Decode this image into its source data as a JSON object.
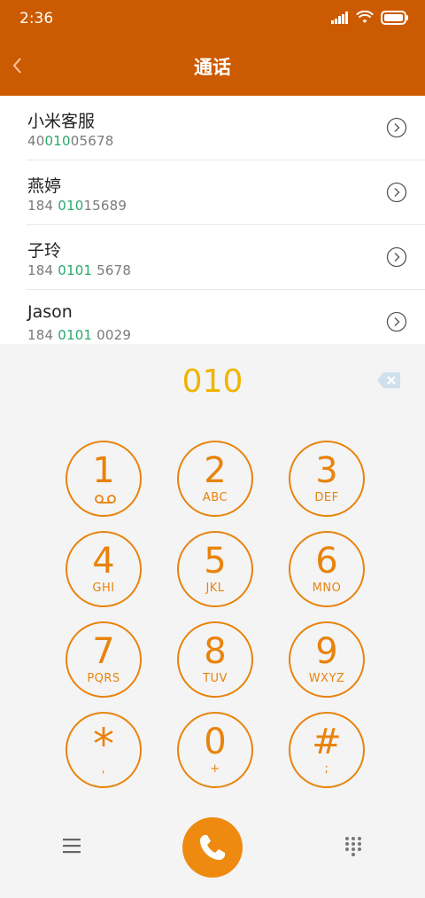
{
  "status_bar": {
    "time": "2:36"
  },
  "header": {
    "title": "通话"
  },
  "results": [
    {
      "name": "小米客服",
      "num_pre": "40",
      "num_hl": "010",
      "num_post": "05678"
    },
    {
      "name": "燕婷",
      "num_pre": "184 ",
      "num_hl": "010",
      "num_post": "15689"
    },
    {
      "name": "子玲",
      "num_pre": "184 ",
      "num_hl": "0101",
      "num_post": " 5678"
    },
    {
      "name": "Jason",
      "num_pre": "184 ",
      "num_hl": "0101",
      "num_post": " 0029"
    }
  ],
  "dialer": {
    "entered": "010",
    "keys": [
      {
        "digit": "1",
        "letters": ""
      },
      {
        "digit": "2",
        "letters": "ABC"
      },
      {
        "digit": "3",
        "letters": "DEF"
      },
      {
        "digit": "4",
        "letters": "GHI"
      },
      {
        "digit": "5",
        "letters": "JKL"
      },
      {
        "digit": "6",
        "letters": "MNO"
      },
      {
        "digit": "7",
        "letters": "PQRS"
      },
      {
        "digit": "8",
        "letters": "TUV"
      },
      {
        "digit": "9",
        "letters": "WXYZ"
      },
      {
        "digit": "*",
        "letters": ","
      },
      {
        "digit": "0",
        "letters": "+"
      },
      {
        "digit": "#",
        "letters": ";"
      }
    ]
  },
  "colors": {
    "header_bg": "#cc5a00",
    "accent": "#ef8a10",
    "display": "#f0b400",
    "highlight": "#2aa86b"
  },
  "icons": [
    "back-chevron-icon",
    "signal-icon",
    "wifi-icon",
    "battery-icon",
    "detail-arrow-icon",
    "backspace-icon",
    "voicemail-icon",
    "menu-icon",
    "phone-icon",
    "dialpad-grid-icon"
  ]
}
